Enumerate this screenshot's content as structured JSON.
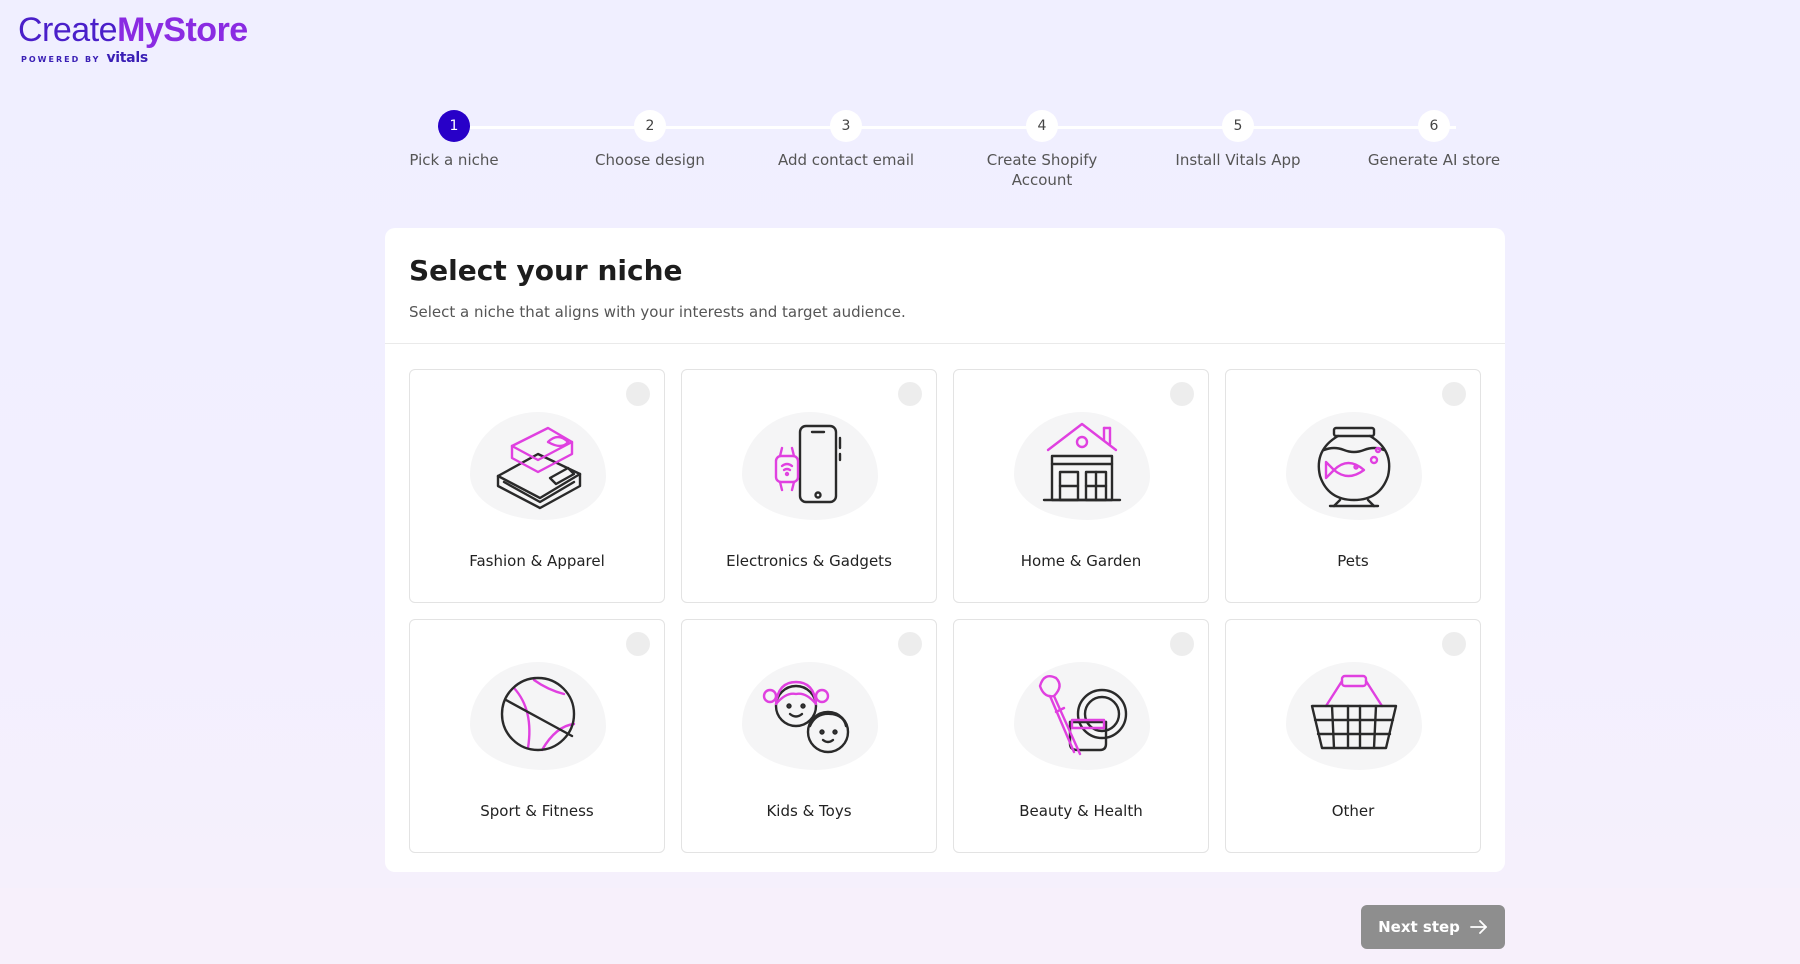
{
  "brand": {
    "name_part1": "Create",
    "name_part2": "MyStore",
    "powered_by": "POWERED BY",
    "partner": "vitals"
  },
  "steps": [
    {
      "num": "1",
      "label": "Pick a niche",
      "active": true
    },
    {
      "num": "2",
      "label": "Choose design",
      "active": false
    },
    {
      "num": "3",
      "label": "Add contact email",
      "active": false
    },
    {
      "num": "4",
      "label": "Create Shopify Account",
      "active": false
    },
    {
      "num": "5",
      "label": "Install Vitals App",
      "active": false
    },
    {
      "num": "6",
      "label": "Generate AI store",
      "active": false
    }
  ],
  "main": {
    "title": "Select your niche",
    "subtitle": "Select a niche that aligns with your interests and target audience."
  },
  "niches": [
    {
      "label": "Fashion & Apparel",
      "icon": "wallet-icon"
    },
    {
      "label": "Electronics & Gadgets",
      "icon": "phone-watch-icon"
    },
    {
      "label": "Home & Garden",
      "icon": "house-icon"
    },
    {
      "label": "Pets",
      "icon": "fishbowl-icon"
    },
    {
      "label": "Sport & Fitness",
      "icon": "basketball-icon"
    },
    {
      "label": "Kids & Toys",
      "icon": "kids-icon"
    },
    {
      "label": "Beauty & Health",
      "icon": "cosmetics-icon"
    },
    {
      "label": "Other",
      "icon": "basket-icon"
    }
  ],
  "footer": {
    "next_label": "Next step"
  },
  "colors": {
    "accent": "#2800c8",
    "brand_purple": "#8a2be2",
    "icon_pink": "#e040e0",
    "button_disabled": "#8e8e8e"
  }
}
